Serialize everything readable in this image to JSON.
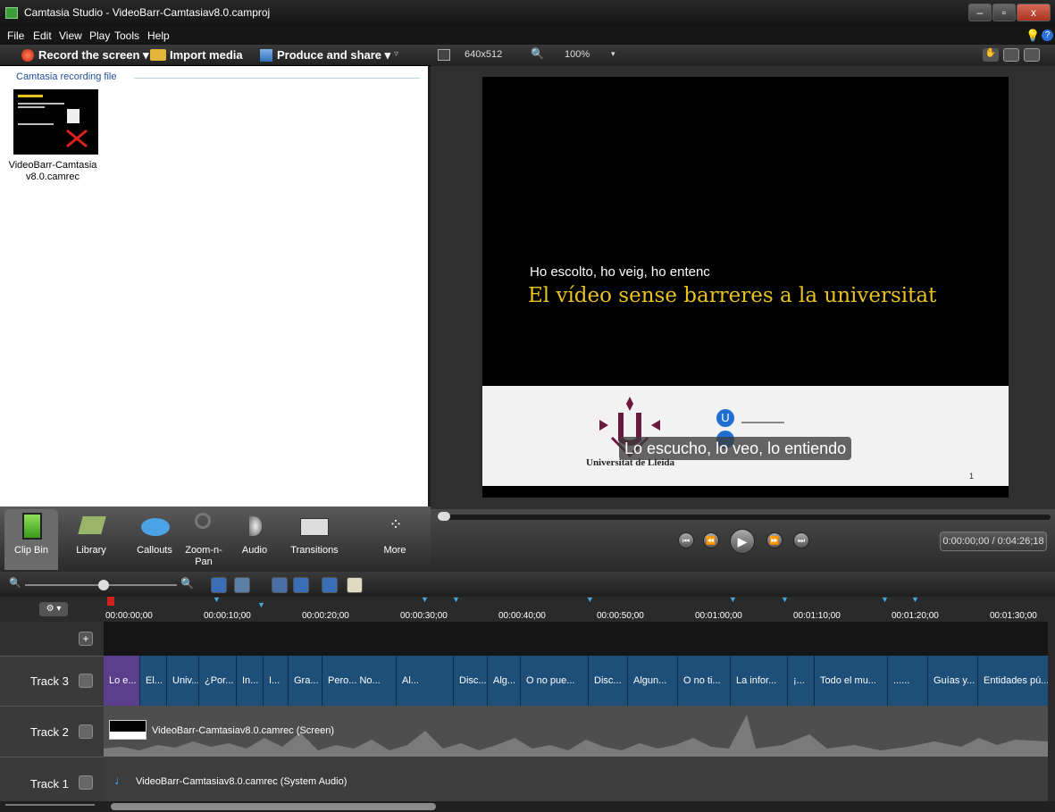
{
  "window": {
    "title": "Camtasia Studio - VideoBarr-Camtasiav8.0.camproj",
    "minimize": "–",
    "maximize": "▫",
    "close": "x"
  },
  "menu": [
    "File",
    "Edit",
    "View",
    "Play",
    "Tools",
    "Help"
  ],
  "toolbar": {
    "record": "Record the screen ▾",
    "import": "Import media",
    "produce": "Produce and share ▾"
  },
  "clipbin": {
    "section": "Camtasia recording file",
    "clip_name_1": "VideoBarr-Camtasia",
    "clip_name_2": "v8.0.camrec"
  },
  "preview": {
    "dimensions": "640x512",
    "zoom": "100%",
    "slide_subtitle": "Ho escolto, ho veig, ho entenc",
    "slide_title": "El vídeo sense barreres a la universitat",
    "caption": "Lo escucho, lo veo, lo entiendo",
    "university": "Universitat de Lleida",
    "page_num": "1"
  },
  "tabs": [
    {
      "label": "Clip Bin",
      "icon": "film-icon"
    },
    {
      "label": "Library",
      "icon": "library-icon"
    },
    {
      "label": "Callouts",
      "icon": "speech-bubble-icon"
    },
    {
      "label": "Zoom-n-\nPan",
      "icon": "magnifier-icon"
    },
    {
      "label": "Audio",
      "icon": "speaker-icon"
    },
    {
      "label": "Transitions",
      "icon": "transition-icon"
    },
    {
      "label": "More",
      "icon": "more-dots-icon"
    }
  ],
  "playback": {
    "time": "0:00:00;00 / 0:04:26;18",
    "progress": 0.0
  },
  "timeline": {
    "ticks": [
      "00:00:00;00",
      "00:00:10;00",
      "00:00:20;00",
      "00:00:30;00",
      "00:00:40;00",
      "00:00:50;00",
      "00:01:00;00",
      "00:01:10;00",
      "00:01:20;00",
      "00:01:30;00"
    ],
    "tracks": [
      {
        "name": "Track 3"
      },
      {
        "name": "Track 2",
        "clip": "VideoBarr-Camtasiav8.0.camrec (Screen)"
      },
      {
        "name": "Track 1",
        "clip": "VideoBarr-Camtasiav8.0.camrec (System Audio)"
      }
    ],
    "captions": [
      "Lo e...",
      "El...",
      "Univ...",
      "¿Por...",
      "In...",
      "I...",
      "Gra...",
      "Pero... No...",
      "Al...",
      "Disc...",
      "Alg...",
      "O no pue...",
      "Disc...",
      "Algun...",
      "O no ti...",
      "La infor...",
      "¡...",
      "Todo el mu...",
      "......",
      "Guías y...",
      "Entidades pú..."
    ]
  },
  "colors": {
    "caption_track": "#1d4f79",
    "first_caption": "#5a3f8c",
    "slide_title": "#e8c21d"
  }
}
